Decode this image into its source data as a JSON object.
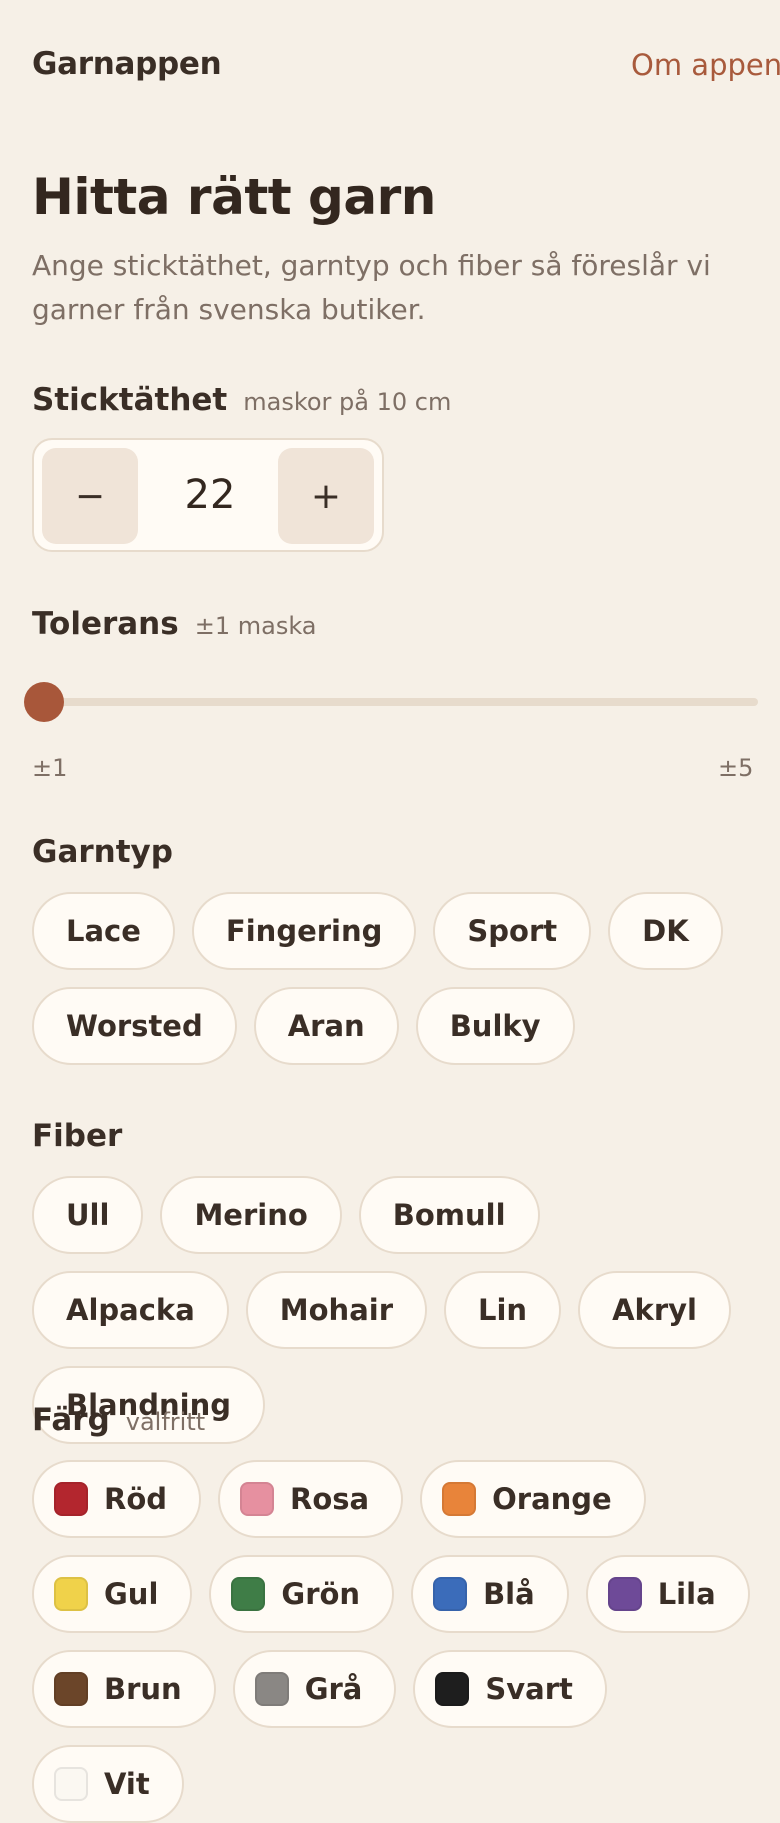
{
  "header": {
    "brand": "Garnappen",
    "about_link": "Om appen"
  },
  "hero": {
    "title": "Hitta rätt garn",
    "lead": "Ange sticktäthet, garntyp och fiber så föreslår vi garner från svenska butiker."
  },
  "gauge": {
    "title": "Sticktäthet",
    "subtitle": "maskor på 10 cm",
    "minus": "−",
    "value": "22",
    "plus": "+"
  },
  "tolerance": {
    "title": "Tolerans",
    "subtitle": "±1 maska",
    "min_label": "±1",
    "max_label": "±5",
    "value_fraction": 0.0,
    "thumb_color": "#a8573a"
  },
  "yarn_types": {
    "title": "Garntyp",
    "options": [
      "Lace",
      "Fingering",
      "Sport",
      "DK",
      "Worsted",
      "Aran",
      "Bulky"
    ]
  },
  "fibers": {
    "title": "Fiber",
    "options": [
      "Ull",
      "Merino",
      "Bomull",
      "Alpacka",
      "Mohair",
      "Lin",
      "Akryl",
      "Blandning"
    ]
  },
  "colors": {
    "title": "Färg",
    "subtitle": "valfritt",
    "options": [
      {
        "label": "Röd",
        "swatch": "#b3262e"
      },
      {
        "label": "Rosa",
        "swatch": "#e690a0"
      },
      {
        "label": "Orange",
        "swatch": "#e8843a"
      },
      {
        "label": "Gul",
        "swatch": "#f0d24a"
      },
      {
        "label": "Grön",
        "swatch": "#3f7d47"
      },
      {
        "label": "Blå",
        "swatch": "#3b6cba"
      },
      {
        "label": "Lila",
        "swatch": "#6e4a98"
      },
      {
        "label": "Brun",
        "swatch": "#6b4529"
      },
      {
        "label": "Grå",
        "swatch": "#8a8784"
      },
      {
        "label": "Svart",
        "swatch": "#1e1e1e"
      },
      {
        "label": "Vit",
        "swatch": "#fbf8f2"
      }
    ]
  }
}
